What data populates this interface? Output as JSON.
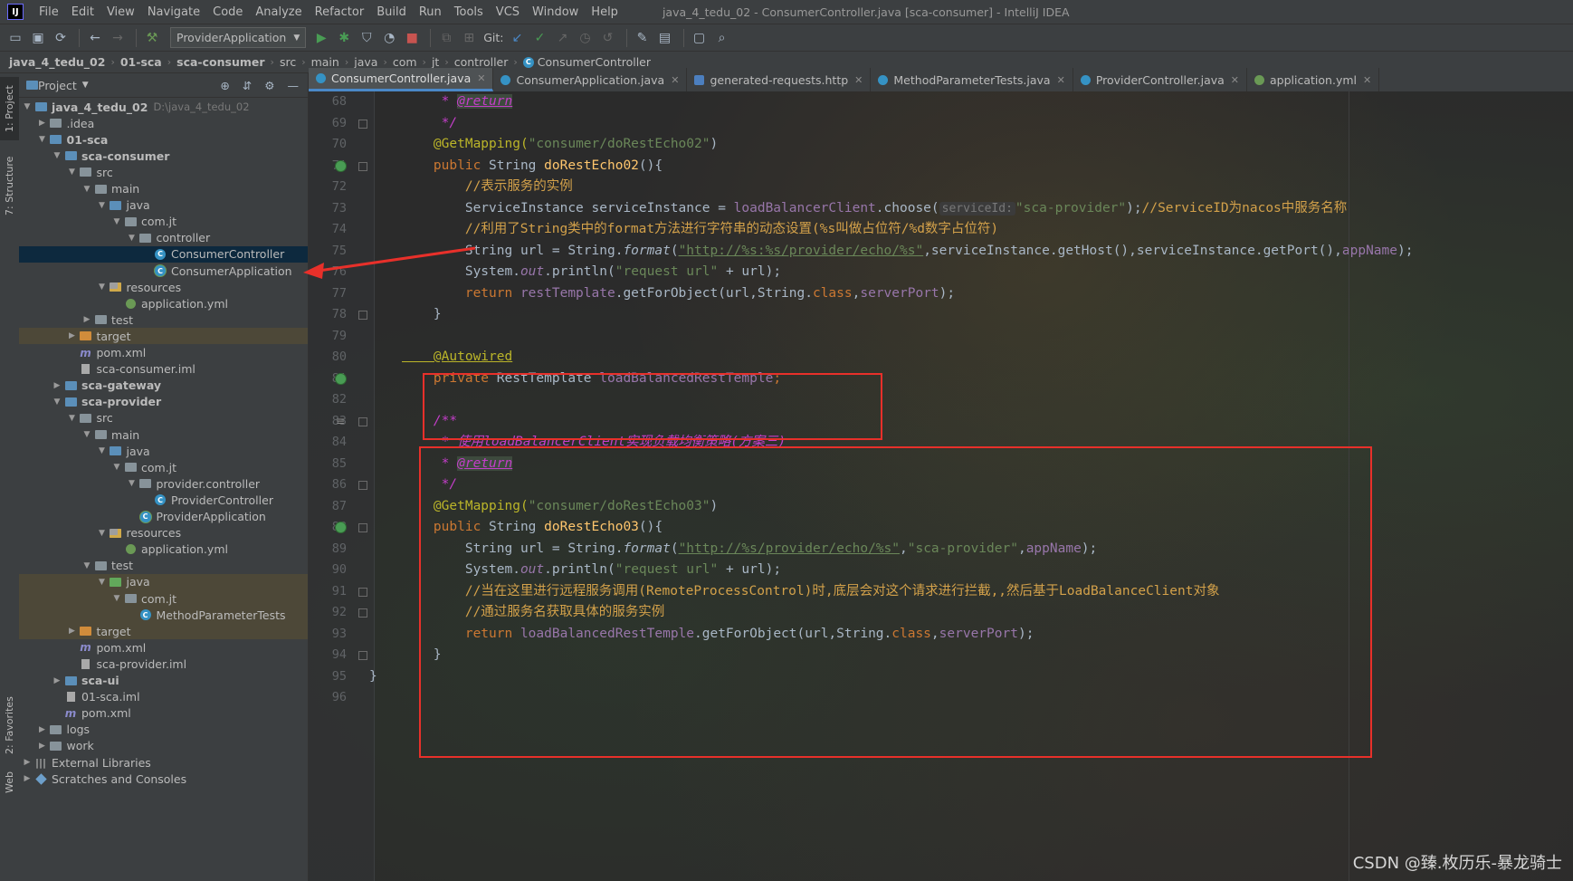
{
  "menubar": {
    "items": [
      "File",
      "Edit",
      "View",
      "Navigate",
      "Code",
      "Analyze",
      "Refactor",
      "Build",
      "Run",
      "Tools",
      "VCS",
      "Window",
      "Help"
    ],
    "title": "java_4_tedu_02 - ConsumerController.java [sca-consumer] - IntelliJ IDEA"
  },
  "toolbar": {
    "run_config": "ProviderApplication",
    "git_label": "Git:"
  },
  "breadcrumb": [
    "java_4_tedu_02",
    "01-sca",
    "sca-consumer",
    "src",
    "main",
    "java",
    "com",
    "jt",
    "controller",
    "ConsumerController"
  ],
  "left_strip": {
    "project_tab": "1: Project",
    "structure_tab": "7: Structure",
    "favorites_tab": "2: Favorites",
    "web_tab": "Web"
  },
  "project": {
    "header": "Project",
    "tree": [
      {
        "label": "java_4_tedu_02",
        "path": "D:\\java_4_tedu_02"
      },
      {
        "label": ".idea"
      },
      {
        "label": "01-sca"
      },
      {
        "label": "sca-consumer"
      },
      {
        "label": "src"
      },
      {
        "label": "main"
      },
      {
        "label": "java"
      },
      {
        "label": "com.jt"
      },
      {
        "label": "controller"
      },
      {
        "label": "ConsumerController"
      },
      {
        "label": "ConsumerApplication"
      },
      {
        "label": "resources"
      },
      {
        "label": "application.yml"
      },
      {
        "label": "test"
      },
      {
        "label": "target"
      },
      {
        "label": "pom.xml"
      },
      {
        "label": "sca-consumer.iml"
      },
      {
        "label": "sca-gateway"
      },
      {
        "label": "sca-provider"
      },
      {
        "label": "src"
      },
      {
        "label": "main"
      },
      {
        "label": "java"
      },
      {
        "label": "com.jt"
      },
      {
        "label": "provider.controller"
      },
      {
        "label": "ProviderController"
      },
      {
        "label": "ProviderApplication"
      },
      {
        "label": "resources"
      },
      {
        "label": "application.yml"
      },
      {
        "label": "test"
      },
      {
        "label": "java"
      },
      {
        "label": "com.jt"
      },
      {
        "label": "MethodParameterTests"
      },
      {
        "label": "target"
      },
      {
        "label": "pom.xml"
      },
      {
        "label": "sca-provider.iml"
      },
      {
        "label": "sca-ui"
      },
      {
        "label": "01-sca.iml"
      },
      {
        "label": "pom.xml"
      },
      {
        "label": "logs"
      },
      {
        "label": "work"
      },
      {
        "label": "External Libraries"
      },
      {
        "label": "Scratches and Consoles"
      }
    ]
  },
  "editor_tabs": [
    "ConsumerController.java",
    "ConsumerApplication.java",
    "generated-requests.http",
    "MethodParameterTests.java",
    "ProviderController.java",
    "application.yml"
  ],
  "line_numbers": [
    "68",
    "69",
    "70",
    "71",
    "72",
    "73",
    "74",
    "75",
    "76",
    "77",
    "78",
    "79",
    "80",
    "81",
    "82",
    "83",
    "84",
    "85",
    "86",
    "87",
    "88",
    "89",
    "90",
    "91",
    "92",
    "93",
    "94",
    "95",
    "96"
  ],
  "code": {
    "l68_star": "     * ",
    "l68_tag": "@return",
    "l69": "     */",
    "l70_ann": "    @GetMapping(",
    "l70_str": "\"consumer/doRestEcho02\"",
    "l70_end": ")",
    "l71_kw": "    public ",
    "l71_type": "String ",
    "l71_name": "doRestEcho02",
    "l71_end": "(){",
    "l72": "        //表示服务的实例",
    "l73_a": "        ServiceInstance serviceInstance = ",
    "l73_fld": "loadBalancerClient",
    "l73_b": ".choose(",
    "l73_hint": "serviceId:",
    "l73_str": "\"sca-provider\"",
    "l73_c": ");",
    "l73_cmt": "//ServiceID为nacos中服务名称",
    "l74": "        //利用了String类中的format方法进行字符串的动态设置(%s叫做占位符/%d数字占位符)",
    "l75_a": "        String url = String.",
    "l75_fmt": "format",
    "l75_b": "(",
    "l75_link": "\"http://%s:%s/provider/echo/%s\"",
    "l75_c": ",serviceInstance.getHost(),serviceInstance.getPort(),",
    "l75_fld": "appName",
    "l75_d": ");",
    "l76_a": "        System.",
    "l76_out": "out",
    "l76_b": ".println(",
    "l76_str": "\"request url\"",
    "l76_c": " + url);",
    "l77_kw": "        return ",
    "l77_fld": "restTemplate",
    "l77_a": ".getForObject(url,String.",
    "l77_cls": "class",
    "l77_b": ",",
    "l77_fld2": "serverPort",
    "l77_c": ");",
    "l78": "    }",
    "l80": "    @Autowired",
    "l81_kw": "    private ",
    "l81_type": "RestTemplate ",
    "l81_fld": "loadBalancedRestTemple",
    "l81_end": ";",
    "l83": "    /**",
    "l84": "     * 使用loadBalancerClient实现负载均衡策略(方案三)",
    "l85_star": "     * ",
    "l85_tag": "@return",
    "l86": "     */",
    "l87_ann": "    @GetMapping(",
    "l87_str": "\"consumer/doRestEcho03\"",
    "l87_end": ")",
    "l88_kw": "    public ",
    "l88_type": "String ",
    "l88_name": "doRestEcho03",
    "l88_end": "(){",
    "l89_a": "        String url = String.",
    "l89_fmt": "format",
    "l89_b": "(",
    "l89_link": "\"http://%s/provider/echo/%s\"",
    "l89_c": ",",
    "l89_str": "\"sca-provider\"",
    "l89_d": ",",
    "l89_fld": "appName",
    "l89_e": ");",
    "l90_a": "        System.",
    "l90_out": "out",
    "l90_b": ".println(",
    "l90_str": "\"request url\"",
    "l90_c": " + url);",
    "l91": "        //当在这里进行远程服务调用(RemoteProcessControl)时,底层会对这个请求进行拦截,,然后基于LoadBalanceClient对象",
    "l92": "        //通过服务名获取具体的服务实例",
    "l93_kw": "        return ",
    "l93_fld": "loadBalancedRestTemple",
    "l93_a": ".getForObject(url,String.",
    "l93_cls": "class",
    "l93_b": ",",
    "l93_fld2": "serverPort",
    "l93_c": ");",
    "l94": "    }",
    "l95": "}"
  },
  "watermark": "CSDN @臻.枚历乐-暴龙骑士",
  "colors": {
    "annotation_box": "#e8302a",
    "selection": "#0d293e",
    "keyword": "#cc7832",
    "string": "#6a8759"
  }
}
